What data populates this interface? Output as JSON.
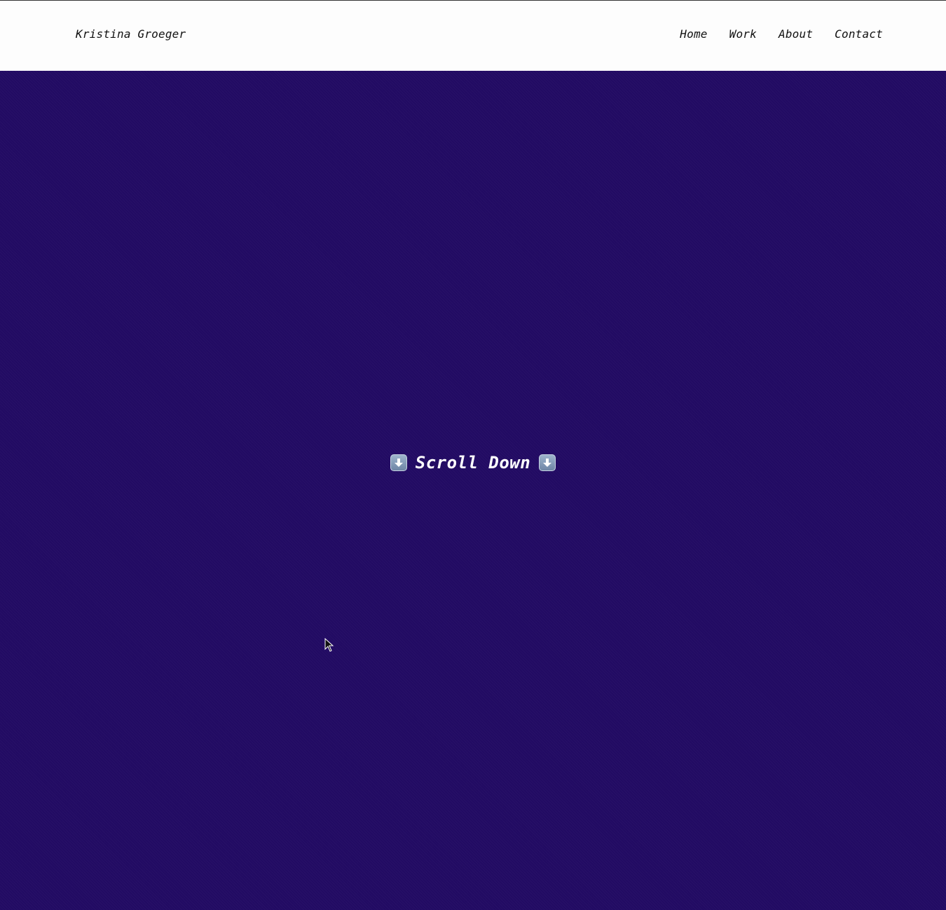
{
  "header": {
    "site_title": "Kristina Groeger",
    "nav": [
      {
        "label": "Home"
      },
      {
        "label": "Work"
      },
      {
        "label": "About"
      },
      {
        "label": "Contact"
      }
    ]
  },
  "hero": {
    "cta_label": "Scroll Down",
    "icons": [
      "down-arrow-icon",
      "down-arrow-icon"
    ],
    "background_color": "#220b63"
  }
}
